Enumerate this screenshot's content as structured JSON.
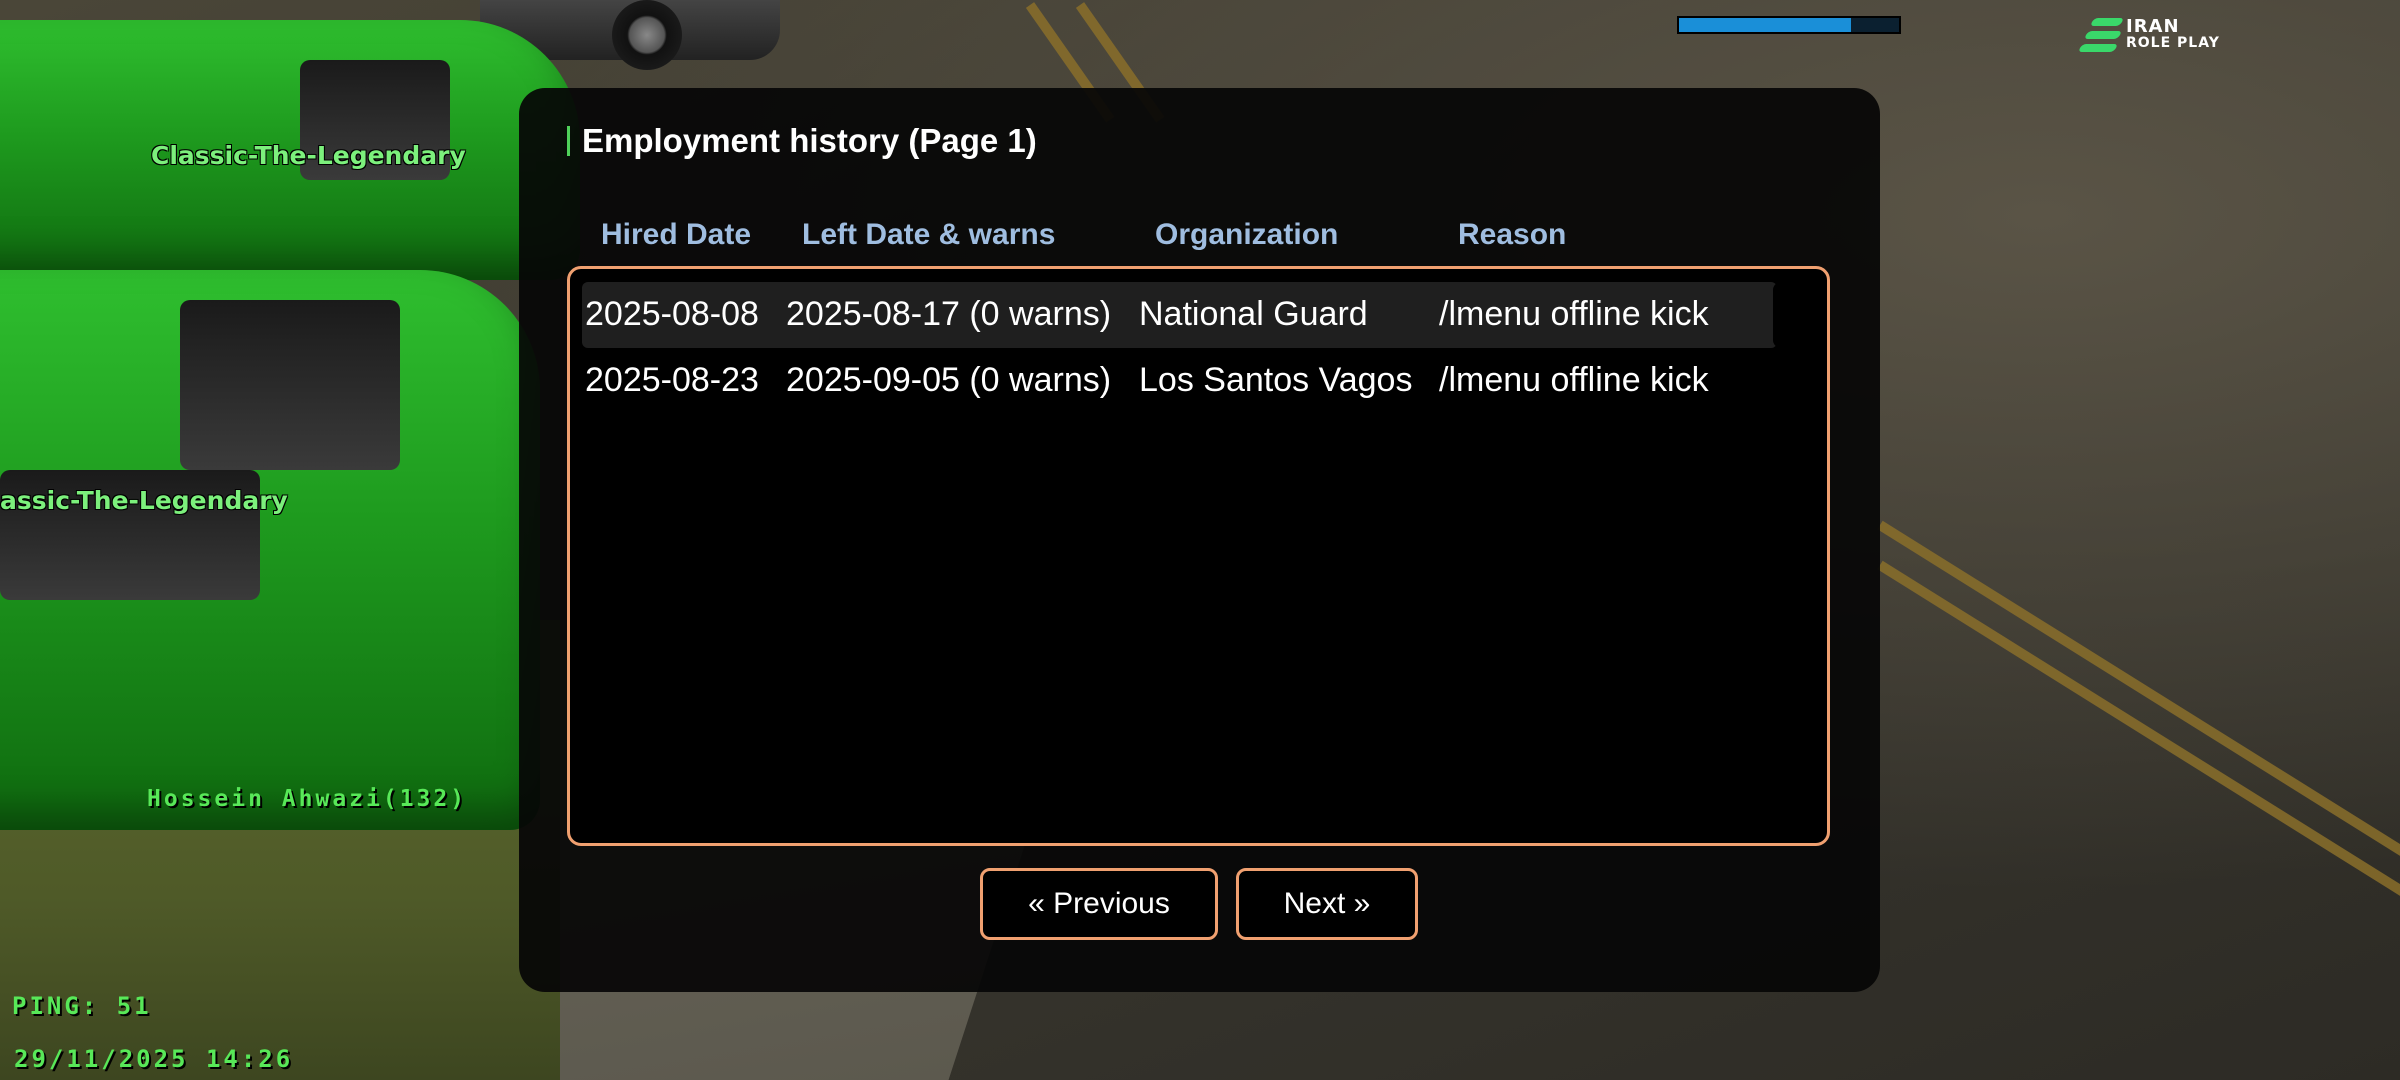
{
  "world": {
    "nametags": [
      "Classic-The-Legendary",
      "assic-The-Legendary",
      "Hossein Ahwazi(132)"
    ],
    "ping": "PING: 51",
    "datetime": "29/11/2025 14:26"
  },
  "hud": {
    "progress_fraction": 0.78,
    "logo_line1": "IRAN",
    "logo_line2": "ROLE PLAY",
    "logo_color": "#3ad86a"
  },
  "dialog": {
    "title": "Employment history (Page 1)",
    "columns": [
      "Hired Date",
      "Left Date & warns",
      "Organization",
      "Reason"
    ],
    "rows": [
      {
        "hired": "2025-08-08",
        "left": "2025-08-17 (0 warns)",
        "organization": "National Guard",
        "reason": "/lmenu offline kick"
      },
      {
        "hired": "2025-08-23",
        "left": "2025-09-05 (0 warns)",
        "organization": "Los Santos Vagos",
        "reason": "/lmenu offline kick"
      }
    ],
    "selected_row": 1,
    "buttons": {
      "previous": "« Previous",
      "next": "Next »"
    },
    "accent_color": "#f0a070",
    "header_color": "#9fbde0"
  }
}
